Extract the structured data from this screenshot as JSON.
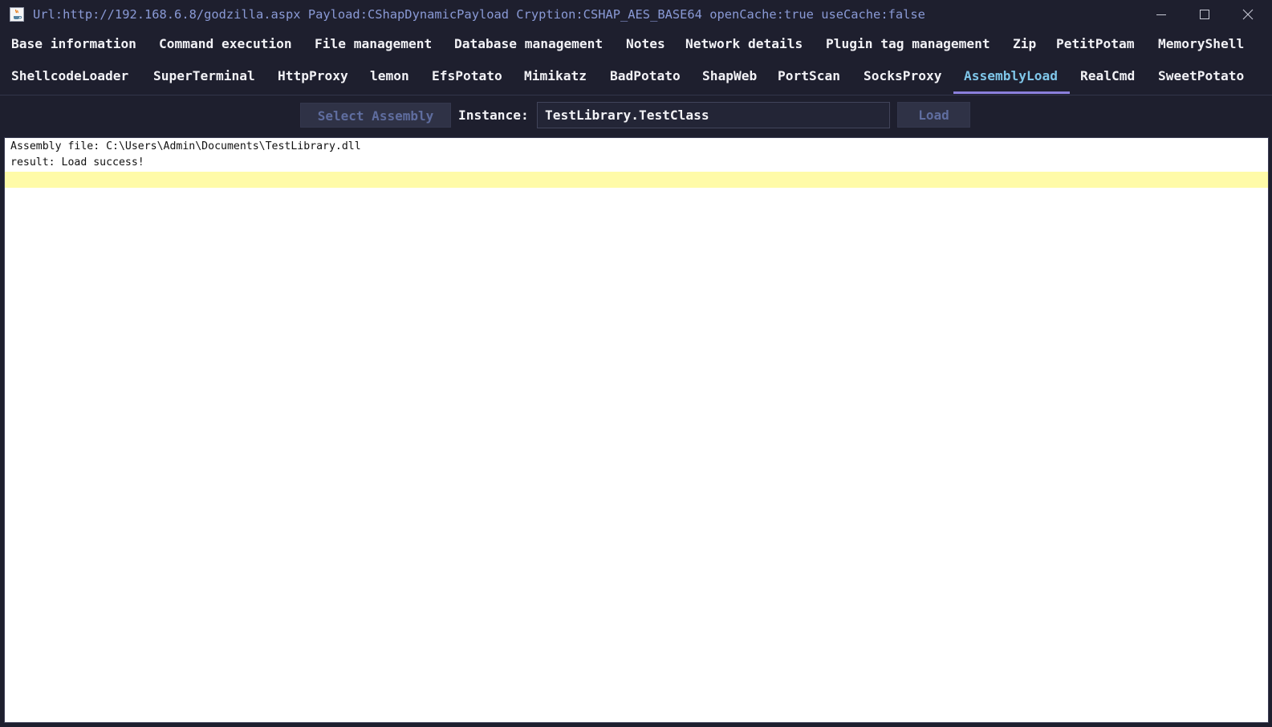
{
  "window": {
    "title": "Url:http://192.168.6.8/godzilla.aspx Payload:CShapDynamicPayload Cryption:CSHAP_AES_BASE64 openCache:true useCache:false",
    "app_icon": "java-cup-icon",
    "controls": [
      "minimize-icon",
      "maximize-icon",
      "close-icon"
    ]
  },
  "tabs": {
    "row1": [
      {
        "label": "Base information"
      },
      {
        "label": "Command execution"
      },
      {
        "label": "File management"
      },
      {
        "label": "Database management"
      },
      {
        "label": "Notes"
      },
      {
        "label": "Network details"
      },
      {
        "label": "Plugin tag management"
      },
      {
        "label": "Zip"
      },
      {
        "label": "PetitPotam"
      },
      {
        "label": "MemoryShell"
      }
    ],
    "row2": [
      {
        "label": "ShellcodeLoader"
      },
      {
        "label": "SuperTerminal"
      },
      {
        "label": "HttpProxy"
      },
      {
        "label": "lemon"
      },
      {
        "label": "EfsPotato"
      },
      {
        "label": "Mimikatz"
      },
      {
        "label": "BadPotato"
      },
      {
        "label": "ShapWeb"
      },
      {
        "label": "PortScan"
      },
      {
        "label": "SocksProxy"
      },
      {
        "label": "AssemblyLoad"
      },
      {
        "label": "RealCmd"
      },
      {
        "label": "SweetPotato"
      }
    ],
    "active": "AssemblyLoad"
  },
  "toolbar": {
    "select_label": "Select Assembly",
    "instance_label": "Instance:",
    "instance_value": "TestLibrary.TestClass",
    "load_label": "Load"
  },
  "output": {
    "lines": [
      "Assembly file: C:\\Users\\Admin\\Documents\\TestLibrary.dll",
      "result: Load success!"
    ]
  },
  "colors": {
    "background": "#1e1f2e",
    "title_text": "#8a9ad6",
    "tab_text": "#f2f2f6",
    "active_tab_text": "#7fc6e9",
    "active_tab_underline": "#8b7fdc",
    "disabled_button_text": "#5f6d9f",
    "current_line_highlight": "#fffba8"
  }
}
